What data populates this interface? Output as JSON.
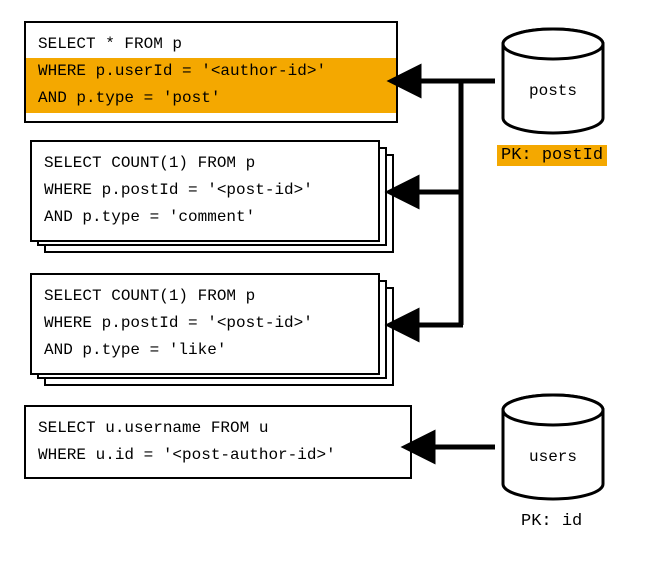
{
  "queries": {
    "q1": {
      "line1": "SELECT * FROM p",
      "line2": "WHERE p.userId = '<author-id>'",
      "line3": "AND p.type = 'post'"
    },
    "q2": {
      "line1": "SELECT COUNT(1) FROM p",
      "line2": "WHERE p.postId = '<post-id>'",
      "line3": "AND p.type = 'comment'"
    },
    "q3": {
      "line1": "SELECT COUNT(1) FROM p",
      "line2": "WHERE p.postId = '<post-id>'",
      "line3": "AND p.type = 'like'"
    },
    "q4": {
      "line1": "SELECT u.username FROM u",
      "line2": "WHERE u.id = '<post-author-id>'"
    }
  },
  "databases": {
    "posts": {
      "label": "posts",
      "pk_prefix": "PK:",
      "pk_field": "postId"
    },
    "users": {
      "label": "users",
      "pk_prefix": "PK:",
      "pk_field": "id"
    }
  }
}
